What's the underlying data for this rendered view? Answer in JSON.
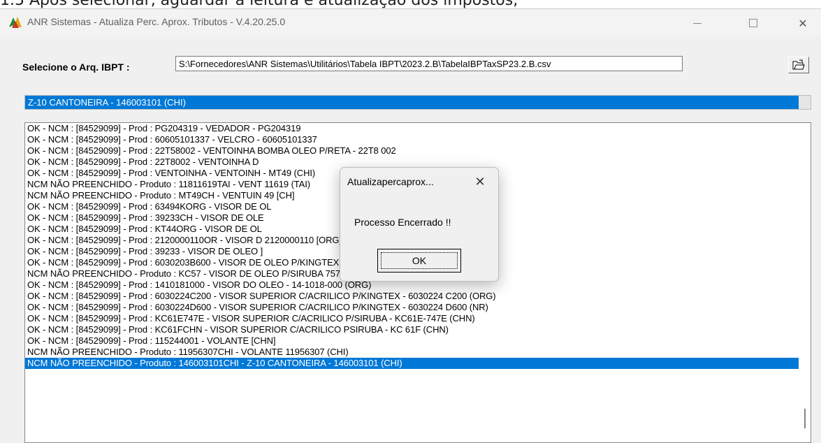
{
  "window": {
    "title": "ANR Sistemas - Atualiza Perc. Aprox. Tributos - V.4.20.25.0",
    "minimize": "—",
    "maximize": "☐",
    "close": "✕"
  },
  "file": {
    "label": "Selecione o Arq. IBPT :",
    "value": "S:\\Fornecedores\\ANR Sistemas\\Utilitários\\Tabela IBPT\\2023.2.B\\TabelaIBPTaxSP23.2.B.csv"
  },
  "progress": {
    "text": "Z-10 CANTONEIRA - 146003101 (CHI)",
    "value_fraction": 0.985
  },
  "log": [
    "OK - NCM : [84529099] - Prod : PG204319 - VEDADOR - PG204319",
    "OK - NCM : [84529099] - Prod : 60605101337 - VELCRO - 60605101337",
    "OK - NCM : [84529099] - Prod : 22T58002 - VENTOINHA BOMBA  OLEO P/RETA  -  22T8 002",
    "OK - NCM : [84529099] - Prod : 22T8002 - VENTOINHA D",
    "OK - NCM : [84529099] - Prod : VENTOINHA - VENTOINH                                                          - MT49 (CHI)",
    "NCM NÃO PREENCHIDO - Produto : 11811619TAI - VENT                                                        11619 (TAI)",
    "NCM NÃO PREENCHIDO - Produto : MT49CH - VENTUIN                                                         49 [CH]",
    "OK - NCM : [84529099] - Prod : 63494KORG - VISOR DE OL",
    "OK - NCM : [84529099] - Prod : 39233CH - VISOR DE OLE",
    "OK - NCM : [84529099] - Prod : KT44ORG - VISOR DE OL",
    "OK - NCM : [84529099] - Prod : 2120000110OR - VISOR D                                                            2120000110 [ORG]",
    "OK - NCM : [84529099] - Prod : 39233 - VISOR DE OLEO                                                         ]",
    "OK - NCM : [84529099] - Prod : 6030203B600 - VISOR DE OLEO P/KINGTEX SH7000",
    "NCM NÃO PREENCHIDO - Produto : KC57 - VISOR DE OLEO P/SIRUBA 757 (ORG)",
    "OK - NCM : [84529099] - Prod : 1410181000 - VISOR DO OLEO - 14-1018-000 (ORG)",
    "OK - NCM : [84529099] - Prod : 6030224C200 - VISOR SUPERIOR C/ACRILICO P/KINGTEX  -  6030224 C200 (ORG)",
    "OK - NCM : [84529099] - Prod : 6030224D600 - VISOR SUPERIOR C/ACRILICO P/KINGTEX  - 6030224 D600 (NR)",
    "OK - NCM : [84529099] - Prod : KC61E747E - VISOR SUPERIOR C/ACRILICO P/SIRUBA  -  KC61E-747E (CHN)",
    "OK - NCM : [84529099] - Prod : KC61FCHN - VISOR SUPERIOR C/ACRILICO PSIRUBA  -  KC 61F  (CHN)",
    "OK - NCM : [84529099] - Prod : 115244001 - VOLANTE  [CHN]",
    "NCM NÃO PREENCHIDO - Produto : 11956307CHI - VOLANTE 11956307 (CHI)",
    "NCM NÃO PREENCHIDO - Produto : 146003101CHI - Z-10 CANTONEIRA - 146003101 (CHI)"
  ],
  "dialog": {
    "title": "Atualizapercaprox...",
    "close": "✕",
    "message": "Processo Encerrado !!",
    "ok": "OK"
  },
  "colors": {
    "selection": "#0078d7"
  }
}
